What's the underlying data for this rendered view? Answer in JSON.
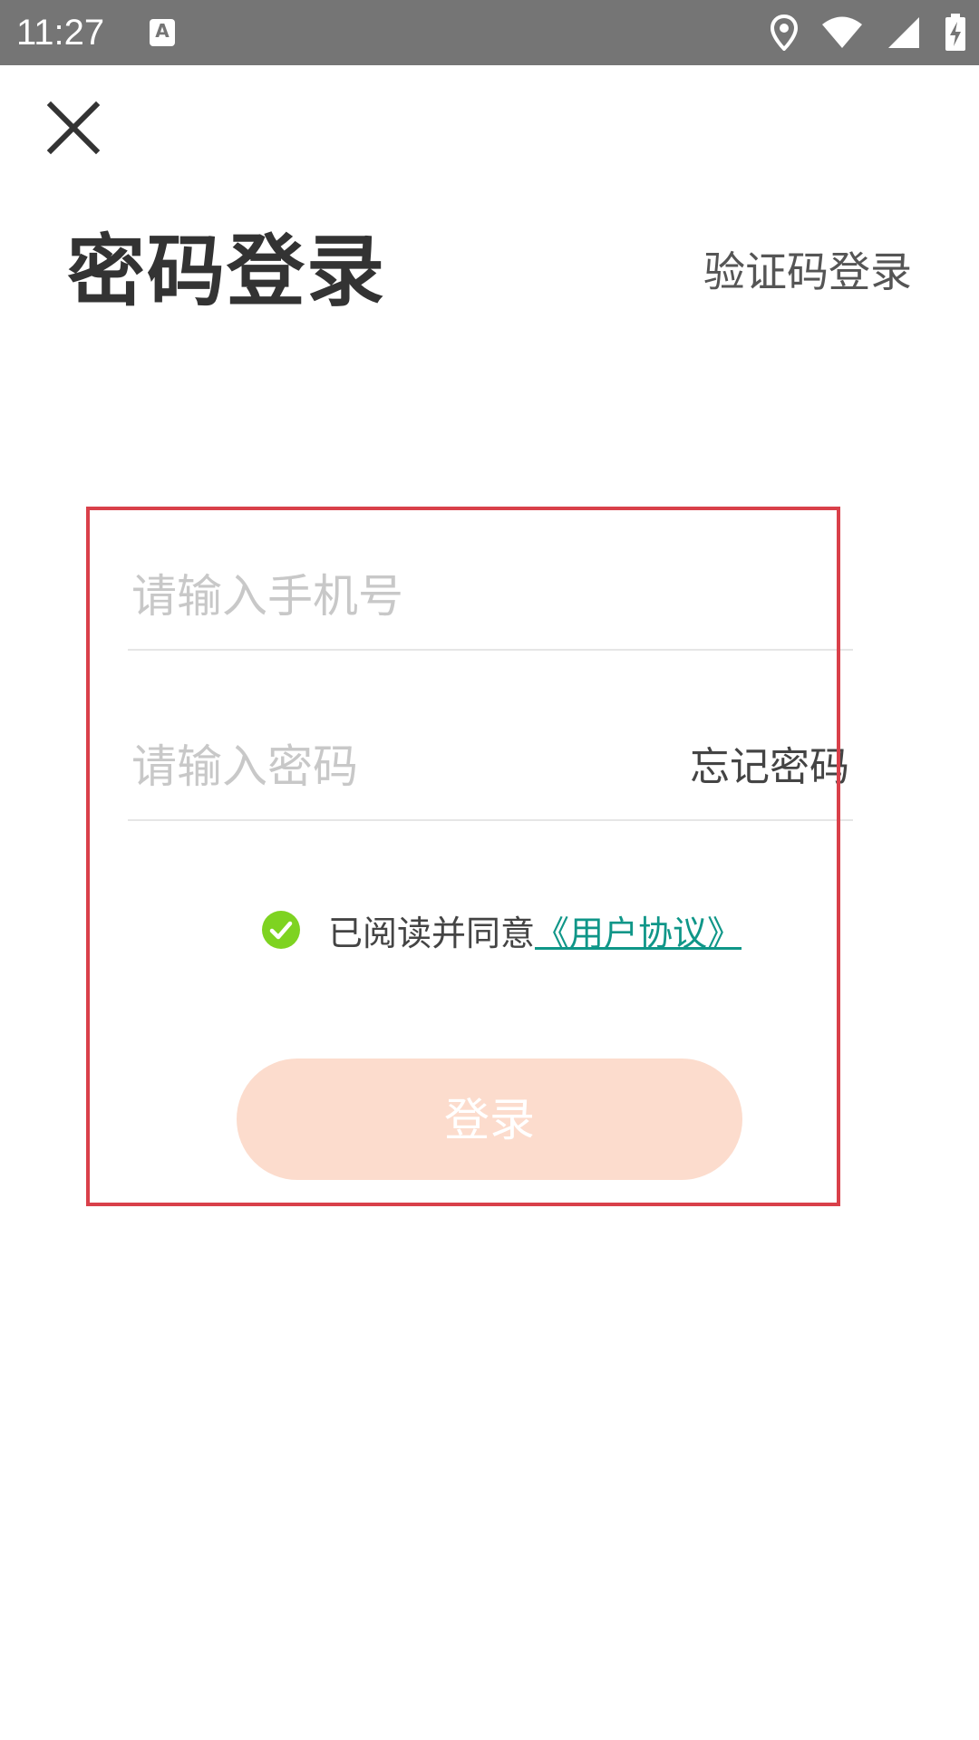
{
  "status_bar": {
    "time": "11:27",
    "notification_icon": "A",
    "icons": [
      "location-icon",
      "wifi-icon",
      "signal-icon",
      "battery-charging-icon"
    ]
  },
  "header": {
    "close_icon": "close-icon",
    "title": "密码登录",
    "switch_mode_label": "验证码登录"
  },
  "form": {
    "phone_placeholder": "请输入手机号",
    "password_placeholder": "请输入密码",
    "forgot_password_label": "忘记密码",
    "agreement_text": "已阅读并同意",
    "agreement_link": "《用户协议》",
    "agreement_checked": true,
    "login_button_label": "登录"
  },
  "colors": {
    "status_bar": "#757575",
    "highlight_border": "#d9404a",
    "check_green": "#7ed321",
    "link": "#0f9688",
    "login_button_disabled": "#fcdccd"
  }
}
